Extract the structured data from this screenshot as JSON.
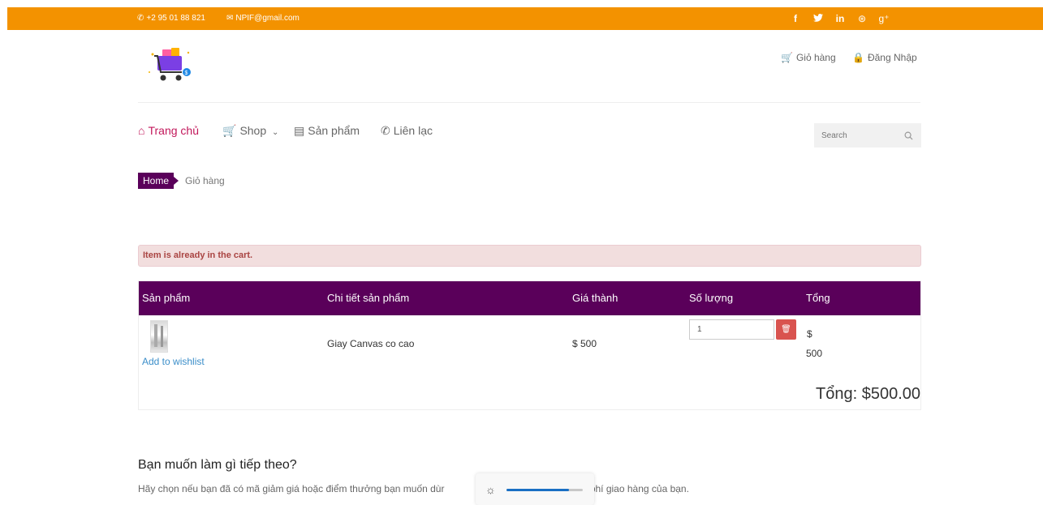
{
  "topbar": {
    "phone": "+2 95 01 88 821",
    "email": "NPIF@gmail.com",
    "social": [
      {
        "icon": "facebook-icon",
        "glyph": "f"
      },
      {
        "icon": "twitter-icon",
        "glyph": "🐦"
      },
      {
        "icon": "linkedin-icon",
        "glyph": "in"
      },
      {
        "icon": "dribbble-icon",
        "glyph": "⊛"
      },
      {
        "icon": "google-plus-icon",
        "glyph": "g⁺"
      }
    ]
  },
  "header": {
    "cart_label": "Giỏ hàng",
    "login_label": "Đăng Nhập"
  },
  "nav": {
    "home": "Trang chủ",
    "shop": "Shop",
    "products": "Sản phẩm",
    "contact": "Liên lạc",
    "search_placeholder": "Search"
  },
  "breadcrumb": {
    "home": "Home",
    "current": "Giỏ hàng"
  },
  "alert": "Item is already in the cart.",
  "cart": {
    "headers": [
      "Sản phẩm",
      "Chi tiết sản phẩm",
      "Giá thành",
      "Số lượng",
      "Tổng"
    ],
    "row": {
      "wishlist": "Add to wishlist",
      "name": "Giay Canvas co cao",
      "price": "$ 500",
      "quantity": "1",
      "total_currency": "$",
      "total_value": "500"
    },
    "grand_total": "Tổng: $500.00"
  },
  "next": {
    "title": "Bạn muốn làm gì tiếp theo?",
    "text_before": "Hãy chọn nếu bạn đã có mã giảm giá hoặc điểm thưởng bạn muốn dùr",
    "text_after": "hi phí giao hàng của bạn."
  },
  "brightness": {
    "level": 0.82
  },
  "colors": {
    "topbar": "#f39200",
    "brand": "#5a005a",
    "active_nav": "#c2185b",
    "danger": "#d9534f",
    "link": "#3b8ec9"
  }
}
